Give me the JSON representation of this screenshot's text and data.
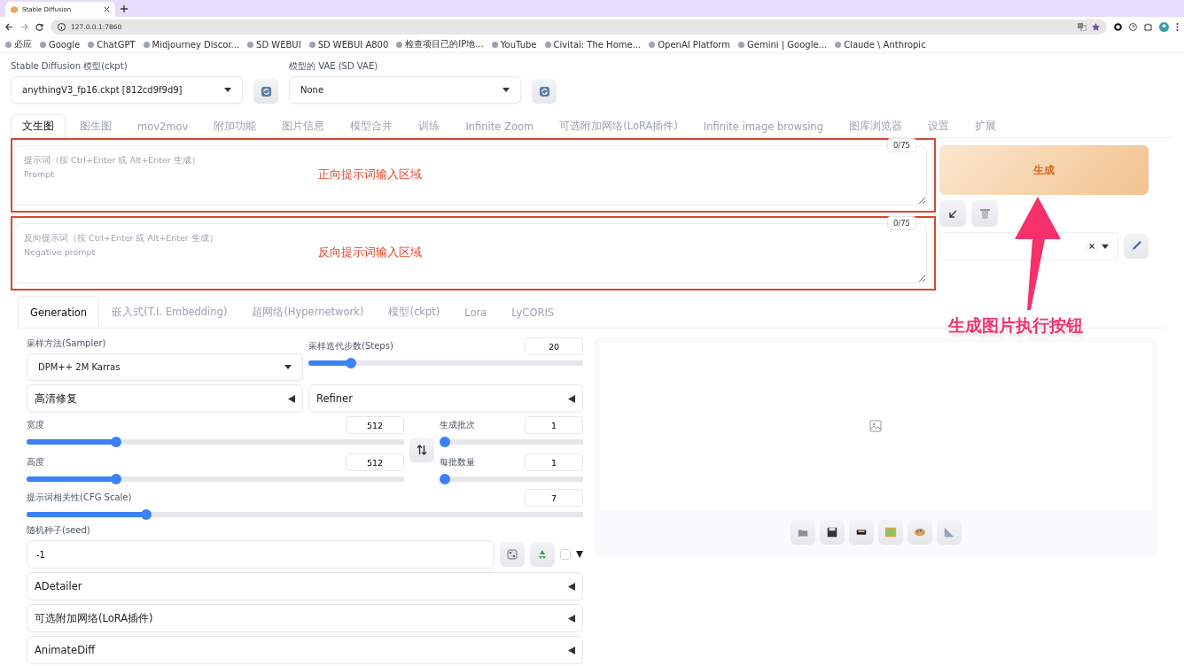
{
  "browser": {
    "tab_title": "Stable Diffusion",
    "url": "127.0.0.1:7860",
    "bookmarks": [
      {
        "label": "必应"
      },
      {
        "label": "Google"
      },
      {
        "label": "ChatGPT"
      },
      {
        "label": "Midjourney Discor..."
      },
      {
        "label": "SD WEBUI"
      },
      {
        "label": "SD WEBUI A800"
      },
      {
        "label": "检查项目已的IP地..."
      },
      {
        "label": "YouTube"
      },
      {
        "label": "Civitai: The Home..."
      },
      {
        "label": "OpenAI Platform"
      },
      {
        "label": "Gemini | Google..."
      },
      {
        "label": "Claude \\ Anthropic"
      }
    ]
  },
  "model_bar": {
    "checkpoint": {
      "label": "Stable Diffusion 模型(ckpt)",
      "value": "anythingV3_fp16.ckpt [812cd9f9d9]"
    },
    "vae": {
      "label": "模型的 VAE (SD VAE)",
      "value": "None"
    }
  },
  "tabs": [
    {
      "label": "文生图",
      "selected": true
    },
    {
      "label": "图生图",
      "selected": false
    },
    {
      "label": "mov2mov",
      "selected": false
    },
    {
      "label": "附加功能",
      "selected": false
    },
    {
      "label": "图片信息",
      "selected": false
    },
    {
      "label": "模型合并",
      "selected": false
    },
    {
      "label": "训练",
      "selected": false
    },
    {
      "label": "Infinite Zoom",
      "selected": false
    },
    {
      "label": "可选附加网络(LoRA插件)",
      "selected": false
    },
    {
      "label": "Infinite image browsing",
      "selected": false
    },
    {
      "label": "图库浏览器",
      "selected": false
    },
    {
      "label": "设置",
      "selected": false
    },
    {
      "label": "扩展",
      "selected": false
    }
  ],
  "prompts": [
    {
      "placeholder": "提示词（按 Ctrl+Enter 或 Alt+Enter 生成）\nPrompt",
      "counter": "0/75",
      "annotation": "正向提示词输入区域"
    },
    {
      "placeholder": "反向提示词（按 Ctrl+Enter 或 Alt+Enter 生成）\nNegative prompt",
      "counter": "0/75",
      "annotation": "反向提示词输入区域"
    }
  ],
  "generate": {
    "label": "生成",
    "annotation": "生成图片执行按钮"
  },
  "subtabs": [
    {
      "label": "Generation",
      "selected": true
    },
    {
      "label": "嵌入式(T.I. Embedding)",
      "selected": false
    },
    {
      "label": "超网络(Hypernetwork)",
      "selected": false
    },
    {
      "label": "模型(ckpt)",
      "selected": false
    },
    {
      "label": "Lora",
      "selected": false
    },
    {
      "label": "LyCORIS",
      "selected": false
    }
  ],
  "sampler": {
    "label": "采样方法(Sampler)",
    "value": "DPM++ 2M Karras"
  },
  "steps": {
    "label": "采样迭代步数(Steps)",
    "value": "20",
    "level": 0.14
  },
  "hires": {
    "label": "高清修复",
    "expanded": false
  },
  "refiner": {
    "label": "Refiner",
    "expanded": false
  },
  "width": {
    "label": "宽度",
    "value": "512",
    "level": 0.23
  },
  "height": {
    "label": "高度",
    "value": "512",
    "level": 0.23
  },
  "batch_count": {
    "label": "生成批次",
    "value": "1",
    "level": 0
  },
  "batch_size": {
    "label": "每批数量",
    "value": "1",
    "level": 0
  },
  "cfg": {
    "label": "提示词相关性(CFG Scale)",
    "value": "7",
    "level": 0.21
  },
  "seed": {
    "label": "随机种子(seed)",
    "value": "-1",
    "extra_checked": false
  },
  "accordions": [
    {
      "label": "ADetailer",
      "expanded": false
    },
    {
      "label": "可选附加网络(LoRA插件)",
      "expanded": false
    },
    {
      "label": "AnimateDiff",
      "expanded": false
    }
  ]
}
